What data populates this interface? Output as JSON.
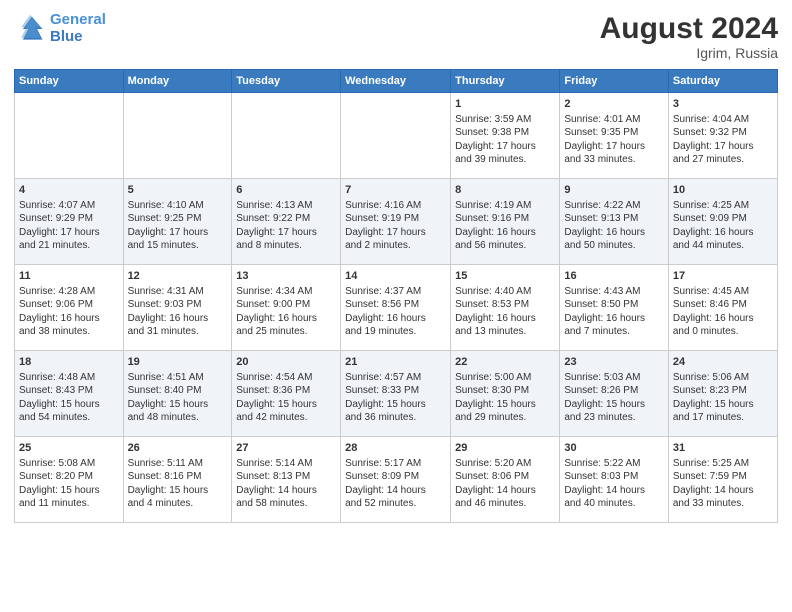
{
  "header": {
    "logo_line1": "General",
    "logo_line2": "Blue",
    "month": "August 2024",
    "location": "Igrim, Russia"
  },
  "days_of_week": [
    "Sunday",
    "Monday",
    "Tuesday",
    "Wednesday",
    "Thursday",
    "Friday",
    "Saturday"
  ],
  "weeks": [
    [
      {
        "day": "",
        "info": ""
      },
      {
        "day": "",
        "info": ""
      },
      {
        "day": "",
        "info": ""
      },
      {
        "day": "",
        "info": ""
      },
      {
        "day": "1",
        "info": "Sunrise: 3:59 AM\nSunset: 9:38 PM\nDaylight: 17 hours\nand 39 minutes."
      },
      {
        "day": "2",
        "info": "Sunrise: 4:01 AM\nSunset: 9:35 PM\nDaylight: 17 hours\nand 33 minutes."
      },
      {
        "day": "3",
        "info": "Sunrise: 4:04 AM\nSunset: 9:32 PM\nDaylight: 17 hours\nand 27 minutes."
      }
    ],
    [
      {
        "day": "4",
        "info": "Sunrise: 4:07 AM\nSunset: 9:29 PM\nDaylight: 17 hours\nand 21 minutes."
      },
      {
        "day": "5",
        "info": "Sunrise: 4:10 AM\nSunset: 9:25 PM\nDaylight: 17 hours\nand 15 minutes."
      },
      {
        "day": "6",
        "info": "Sunrise: 4:13 AM\nSunset: 9:22 PM\nDaylight: 17 hours\nand 8 minutes."
      },
      {
        "day": "7",
        "info": "Sunrise: 4:16 AM\nSunset: 9:19 PM\nDaylight: 17 hours\nand 2 minutes."
      },
      {
        "day": "8",
        "info": "Sunrise: 4:19 AM\nSunset: 9:16 PM\nDaylight: 16 hours\nand 56 minutes."
      },
      {
        "day": "9",
        "info": "Sunrise: 4:22 AM\nSunset: 9:13 PM\nDaylight: 16 hours\nand 50 minutes."
      },
      {
        "day": "10",
        "info": "Sunrise: 4:25 AM\nSunset: 9:09 PM\nDaylight: 16 hours\nand 44 minutes."
      }
    ],
    [
      {
        "day": "11",
        "info": "Sunrise: 4:28 AM\nSunset: 9:06 PM\nDaylight: 16 hours\nand 38 minutes."
      },
      {
        "day": "12",
        "info": "Sunrise: 4:31 AM\nSunset: 9:03 PM\nDaylight: 16 hours\nand 31 minutes."
      },
      {
        "day": "13",
        "info": "Sunrise: 4:34 AM\nSunset: 9:00 PM\nDaylight: 16 hours\nand 25 minutes."
      },
      {
        "day": "14",
        "info": "Sunrise: 4:37 AM\nSunset: 8:56 PM\nDaylight: 16 hours\nand 19 minutes."
      },
      {
        "day": "15",
        "info": "Sunrise: 4:40 AM\nSunset: 8:53 PM\nDaylight: 16 hours\nand 13 minutes."
      },
      {
        "day": "16",
        "info": "Sunrise: 4:43 AM\nSunset: 8:50 PM\nDaylight: 16 hours\nand 7 minutes."
      },
      {
        "day": "17",
        "info": "Sunrise: 4:45 AM\nSunset: 8:46 PM\nDaylight: 16 hours\nand 0 minutes."
      }
    ],
    [
      {
        "day": "18",
        "info": "Sunrise: 4:48 AM\nSunset: 8:43 PM\nDaylight: 15 hours\nand 54 minutes."
      },
      {
        "day": "19",
        "info": "Sunrise: 4:51 AM\nSunset: 8:40 PM\nDaylight: 15 hours\nand 48 minutes."
      },
      {
        "day": "20",
        "info": "Sunrise: 4:54 AM\nSunset: 8:36 PM\nDaylight: 15 hours\nand 42 minutes."
      },
      {
        "day": "21",
        "info": "Sunrise: 4:57 AM\nSunset: 8:33 PM\nDaylight: 15 hours\nand 36 minutes."
      },
      {
        "day": "22",
        "info": "Sunrise: 5:00 AM\nSunset: 8:30 PM\nDaylight: 15 hours\nand 29 minutes."
      },
      {
        "day": "23",
        "info": "Sunrise: 5:03 AM\nSunset: 8:26 PM\nDaylight: 15 hours\nand 23 minutes."
      },
      {
        "day": "24",
        "info": "Sunrise: 5:06 AM\nSunset: 8:23 PM\nDaylight: 15 hours\nand 17 minutes."
      }
    ],
    [
      {
        "day": "25",
        "info": "Sunrise: 5:08 AM\nSunset: 8:20 PM\nDaylight: 15 hours\nand 11 minutes."
      },
      {
        "day": "26",
        "info": "Sunrise: 5:11 AM\nSunset: 8:16 PM\nDaylight: 15 hours\nand 4 minutes."
      },
      {
        "day": "27",
        "info": "Sunrise: 5:14 AM\nSunset: 8:13 PM\nDaylight: 14 hours\nand 58 minutes."
      },
      {
        "day": "28",
        "info": "Sunrise: 5:17 AM\nSunset: 8:09 PM\nDaylight: 14 hours\nand 52 minutes."
      },
      {
        "day": "29",
        "info": "Sunrise: 5:20 AM\nSunset: 8:06 PM\nDaylight: 14 hours\nand 46 minutes."
      },
      {
        "day": "30",
        "info": "Sunrise: 5:22 AM\nSunset: 8:03 PM\nDaylight: 14 hours\nand 40 minutes."
      },
      {
        "day": "31",
        "info": "Sunrise: 5:25 AM\nSunset: 7:59 PM\nDaylight: 14 hours\nand 33 minutes."
      }
    ]
  ]
}
